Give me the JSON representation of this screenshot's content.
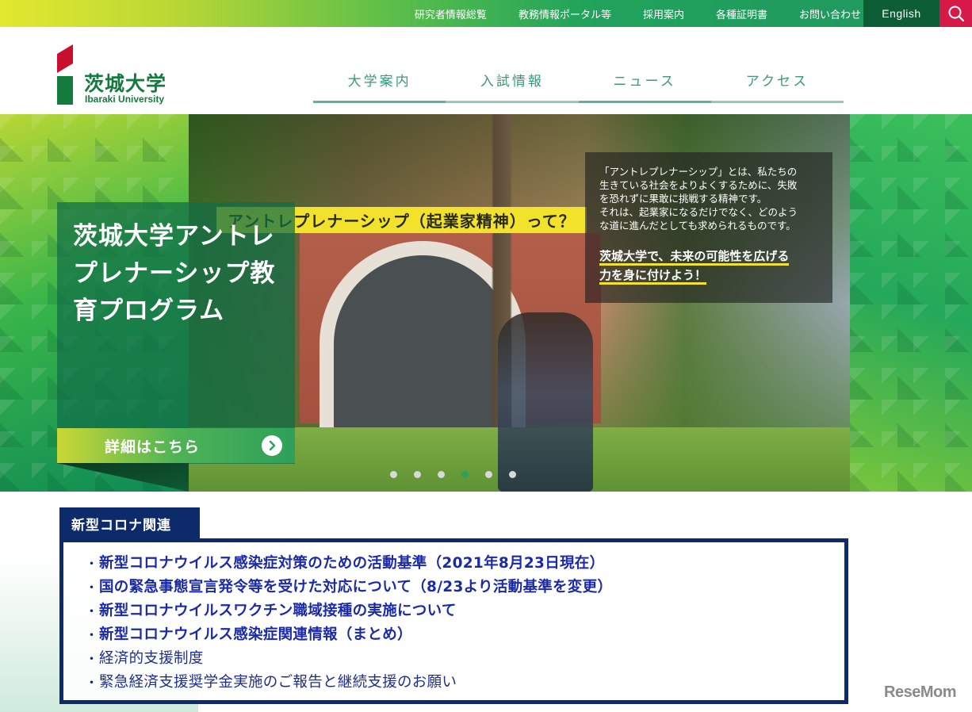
{
  "topbar": {
    "links": [
      "研究者情報総覧",
      "教務情報ポータル等",
      "採用案内",
      "各種証明書",
      "お問い合わせ"
    ],
    "english_label": "English",
    "search_icon": "search-icon"
  },
  "header": {
    "logo_jp": "茨城大学",
    "logo_en": "Ibaraki University",
    "nav": [
      "大学案内",
      "入試情報",
      "ニュース",
      "アクセス"
    ]
  },
  "hero": {
    "card_title": "茨城大学アントレプレナーシップ教育プログラム",
    "button_label": "詳細はこちら",
    "photo_caption": "アントレプレナーシップ（起業家精神）って？",
    "photo_text": [
      "「アントレプレナーシップ」とは、私たちの",
      "生きている社会をよりよくするために、失敗",
      "を恐れずに果敢に挑戦する精神です。",
      "それは、起業家になるだけでなく、どのよう",
      "な道に進んだとしても求められるものです。"
    ],
    "photo_highlight": [
      "茨城大学で、未来の可能性を広げる",
      "力を身に付けよう！"
    ],
    "slide_count": 6,
    "active_slide": 4
  },
  "corona": {
    "tab_label": "新型コロナ関連",
    "items": [
      {
        "bullet": "・",
        "text": "新型コロナウイルス感染症対策のための活動基準（2021年8月23日現在）",
        "bold": true
      },
      {
        "bullet": "・",
        "text": "国の緊急事態宣言発令等を受けた対応について（8/23より活動基準を変更）",
        "bold": true
      },
      {
        "bullet": "・",
        "text": "新型コロナウイルスワクチン職域接種の実施について",
        "bold": true
      },
      {
        "bullet": "・",
        "text": "新型コロナウイルス感染症関連情報（まとめ）",
        "bold": true
      },
      {
        "bullet": "・",
        "text": "経済的支援制度",
        "bold": false
      },
      {
        "bullet": "・",
        "text": "緊急経済支援奨学金実施のご報告と継続支援のお願い",
        "bold": false
      }
    ]
  },
  "watermark": "ReseMom",
  "colors": {
    "brand_green": "#157a3e",
    "navy": "#0d2a6b",
    "search_red": "#d7194a",
    "english_bg": "#0d5e36",
    "accent_yellow": "#f3e22b"
  }
}
